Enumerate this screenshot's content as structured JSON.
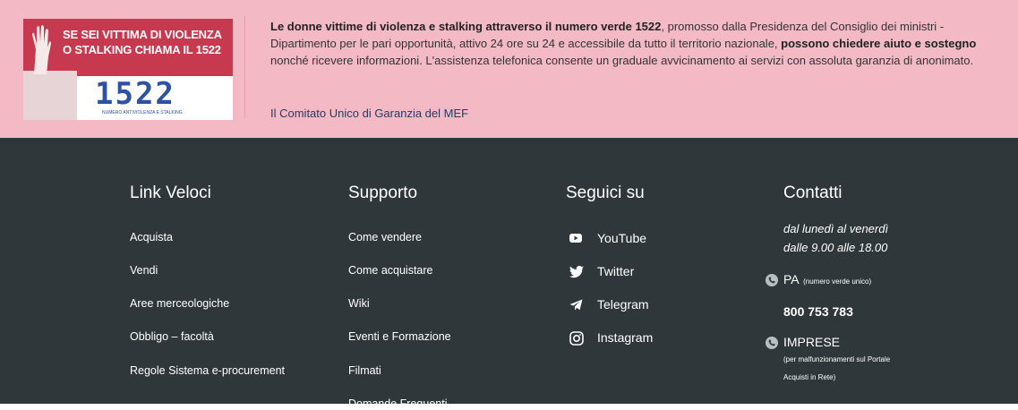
{
  "banner": {
    "badge": {
      "line1": "SE SEI VITTIMA DI VIOLENZA",
      "line2": "O STALKING CHIAMA IL 1522",
      "number": "1522",
      "subtitle": "NUMERO ANTIVIOLENZA E STALKING"
    },
    "text": {
      "p1_bold": "Le donne vittime di violenza e stalking attraverso il numero verde 1522",
      "p2": ", promosso dalla Presidenza del Consiglio dei ministri - Dipartimento per le pari opportunità, attivo 24 ore su 24 e accessibile da tutto il territorio nazionale, ",
      "p3_bold": "possono chiedere aiuto e sostegno",
      "p4": " nonché ricevere informazioni. L'assistenza telefonica consente un graduale avvicinamento ai servizi con assoluta garanzia di anonimato."
    },
    "link": "Il Comitato Unico di Garanzia del MEF"
  },
  "footer": {
    "quick_links": {
      "title": "Link Veloci",
      "items": [
        "Acquista",
        "Vendi",
        "Aree merceologiche",
        "Obbligo – facoltà",
        "Regole Sistema e-procurement"
      ]
    },
    "support": {
      "title": "Supporto",
      "items": [
        "Come vendere",
        "Come acquistare",
        "Wiki",
        "Eventi e Formazione",
        "Filmati",
        "Domande Frequenti"
      ]
    },
    "social": {
      "title": "Seguici su",
      "items": [
        {
          "label": "YouTube",
          "icon": "youtube-icon"
        },
        {
          "label": "Twitter",
          "icon": "twitter-icon"
        },
        {
          "label": "Telegram",
          "icon": "telegram-icon"
        },
        {
          "label": "Instagram",
          "icon": "instagram-icon"
        }
      ]
    },
    "contacts": {
      "title": "Contatti",
      "hours_line1": "dal lunedì al venerdì",
      "hours_line2": "dalle 9.00 alle 18.00",
      "pa_label": "PA",
      "pa_note": "(numero verde unico)",
      "pa_number": "800 753 783",
      "imprese_label": "IMPRESE",
      "imprese_note1": "(per malfunzionamenti sul Portale",
      "imprese_note2": "Acquisti in Rete)"
    }
  }
}
